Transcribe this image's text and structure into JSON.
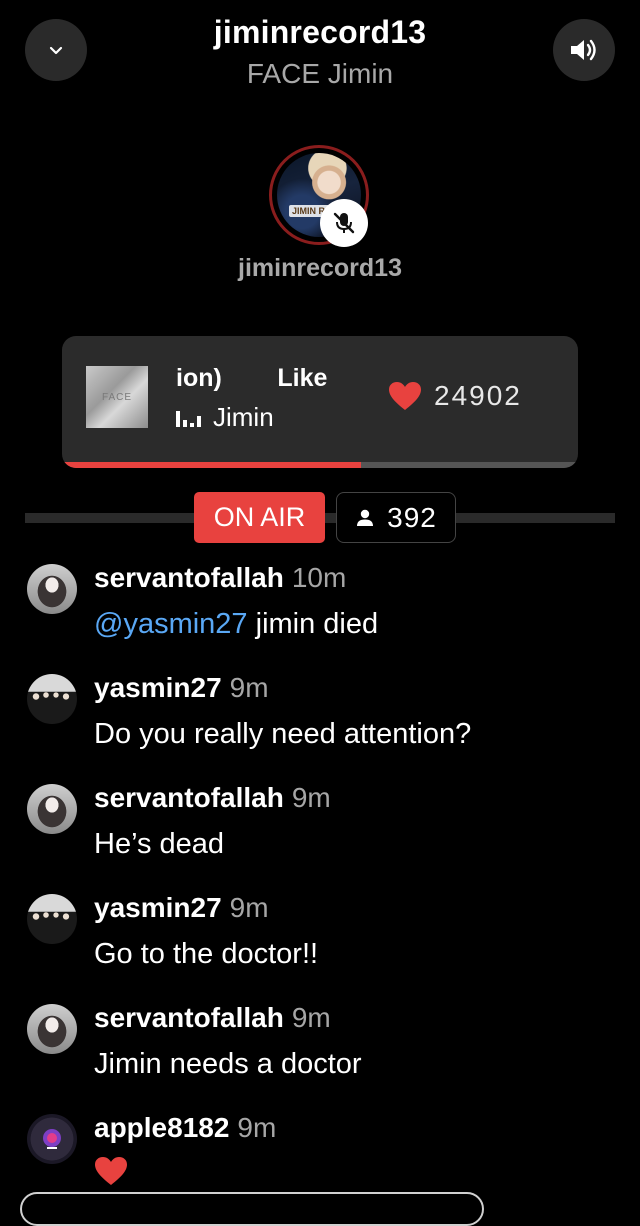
{
  "header": {
    "title": "jiminrecord13",
    "subtitle": "FACE Jimin",
    "collapse_icon": "chevron-down-icon",
    "sound_icon": "speaker-icon"
  },
  "host": {
    "name": "jiminrecord13",
    "avatar_logo_text": "JIMIN REC",
    "status_icon": "mic-muted-icon"
  },
  "now_playing": {
    "title_visible": "ion)        Like",
    "artist": "Jimin",
    "like_count": "24902",
    "progress": 0.58,
    "album_text": "FACE"
  },
  "live": {
    "badge": "ON AIR",
    "listener_count": "392"
  },
  "colors": {
    "accent_red": "#e8423f",
    "mention_blue": "#5aa8f5",
    "card_bg": "#2b2b2b"
  },
  "chat": [
    {
      "user": "servantofallah",
      "time": "10m",
      "mention": "@yasmin27",
      "text": " jimin died",
      "avatar": "girl"
    },
    {
      "user": "yasmin27",
      "time": "9m",
      "mention": "",
      "text": "Do you really need attention?",
      "avatar": "group"
    },
    {
      "user": "servantofallah",
      "time": "9m",
      "mention": "",
      "text": "He’s dead",
      "avatar": "girl"
    },
    {
      "user": "yasmin27",
      "time": "9m",
      "mention": "",
      "text": "Go to the doctor!!",
      "avatar": "group"
    },
    {
      "user": "servantofallah",
      "time": "9m",
      "mention": "",
      "text": "Jimin needs a doctor",
      "avatar": "girl"
    },
    {
      "user": "apple8182",
      "time": "9m",
      "mention": "",
      "text": "",
      "avatar": "apple",
      "reaction_icon": "heart-icon"
    }
  ]
}
